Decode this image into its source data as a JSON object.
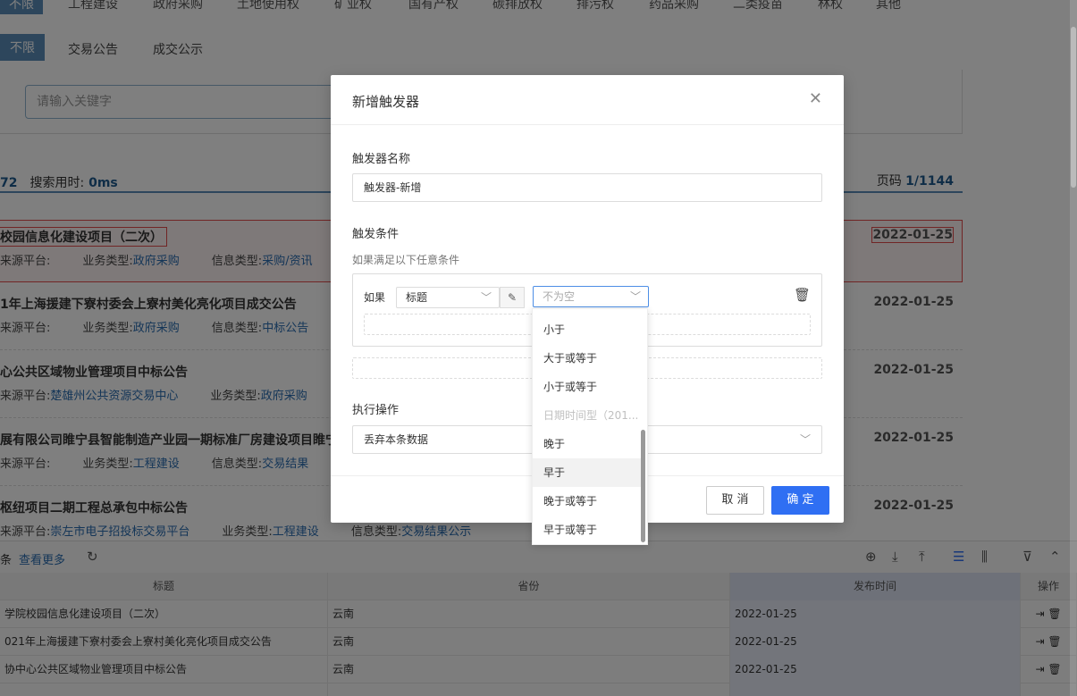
{
  "categories": [
    "不限",
    "工程建设",
    "政府采购",
    "土地使用权",
    "矿业权",
    "国有产权",
    "碳排放权",
    "排污权",
    "药品采购",
    "二类疫苗",
    "林权",
    "其他"
  ],
  "subcategories": [
    "不限",
    "交易公告",
    "成交公示"
  ],
  "search": {
    "placeholder": "请输入关键字"
  },
  "stats": {
    "count": "72",
    "time_label": "搜索用时:",
    "time_value": "0ms",
    "page_label": "页码",
    "page_value": "1/1144"
  },
  "results": [
    {
      "title": "校园信息化建设项目（二次）",
      "date": "2022-01-25",
      "m1": "来源平台:",
      "m2": "业务类型:",
      "m2v": "政府采购",
      "m3": "信息类型:",
      "m3v": "采购/资讯"
    },
    {
      "title": "1年上海援建下寮村委会上寮村美化亮化项目成交公告",
      "date": "2022-01-25",
      "m1": "来源平台:",
      "m2": "业务类型:",
      "m2v": "政府采购",
      "m3": "信息类型:",
      "m3v": "中标公告"
    },
    {
      "title": "心公共区域物业管理项目中标公告",
      "date": "2022-01-25",
      "m1": "来源平台:",
      "m1v": "楚雄州公共资源交易中心",
      "m2": "业务类型:",
      "m2v": "政府采购"
    },
    {
      "title": "展有限公司睢宁县智能制造产业园一期标准厂房建设项目睢宁",
      "date": "2022-01-25",
      "m1": "来源平台:",
      "m2": "业务类型:",
      "m2v": "工程建设",
      "m3": "信息类型:",
      "m3v": "交易结果"
    },
    {
      "title": "枢纽项目二期工程总承包中标公告",
      "date": "2022-01-25",
      "m1": "来源平台:",
      "m1v": "崇左市电子招投标交易平台",
      "m2": "业务类型:",
      "m2v": "工程建设",
      "m3": "信息类型:",
      "m3v": "交易结果公示"
    }
  ],
  "panel": {
    "tools_prefix": "条",
    "more_link": "查看更多",
    "headers": [
      "标题",
      "省份",
      "发布时间",
      "操作"
    ],
    "rows": [
      {
        "title": "学院校园信息化建设项目（二次）",
        "province": "云南",
        "date": "2022-01-25"
      },
      {
        "title": "021年上海援建下寮村委会上寮村美化亮化项目成交公告",
        "province": "云南",
        "date": "2022-01-25"
      },
      {
        "title": "协中心公共区域物业管理项目中标公告",
        "province": "云南",
        "date": "2022-01-25"
      },
      {
        "title": "",
        "province": "",
        "date": ""
      }
    ]
  },
  "modal": {
    "title": "新增触发器",
    "name_label": "触发器名称",
    "name_value": "触发器-新增",
    "cond_label": "触发条件",
    "cond_hint": "如果满足以下任意条件",
    "if_label": "如果",
    "field_value": "标题",
    "op_placeholder": "不为空",
    "exec_label": "执行操作",
    "exec_value": "丢弃本条数据",
    "cancel": "取 消",
    "ok": "确 定"
  },
  "dropdown": {
    "items": [
      "小于",
      "大于或等于",
      "小于或等于",
      "日期时间型（201...",
      "晚于",
      "早于",
      "晚于或等于",
      "早于或等于"
    ],
    "disabled_index": 3,
    "hover_index": 5
  },
  "colors": {
    "accent": "#5b8db8",
    "primary": "#2f6ff3",
    "highlight": "#e24a4a",
    "link": "#2a6db0"
  }
}
